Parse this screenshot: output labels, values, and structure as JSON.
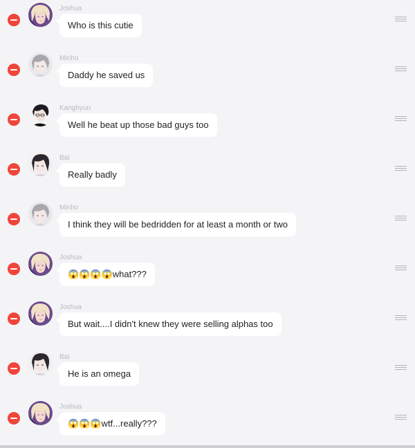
{
  "messages": [
    {
      "name": "Joshua",
      "text": "Who is this cutie",
      "avatar": "joshua"
    },
    {
      "name": "Minho",
      "text": "Daddy he saved us",
      "avatar": "minho"
    },
    {
      "name": "Kanghyun",
      "text": "Well he beat up those bad guys too",
      "avatar": "kanghyun"
    },
    {
      "name": "Bai",
      "text": "Really badly",
      "avatar": "bai"
    },
    {
      "name": "Minho",
      "text": "I think they will be bedridden for at least a month or two",
      "avatar": "minho"
    },
    {
      "name": "Joshua",
      "text": "😱😱😱😱what???",
      "avatar": "joshua"
    },
    {
      "name": "Joshua",
      "text": "But wait....I didn't knew they were selling alphas too",
      "avatar": "joshua"
    },
    {
      "name": "Bai",
      "text": "He is an omega",
      "avatar": "bai"
    },
    {
      "name": "Joshua",
      "text": "😱😱😱wtf...really???",
      "avatar": "joshua"
    }
  ],
  "colors": {
    "background": "#f4f4f6",
    "delete_button": "#f0453a",
    "bubble": "#ffffff",
    "name_text": "#b9b9bf",
    "message_text": "#222226",
    "handle": "#b3b3b8"
  }
}
